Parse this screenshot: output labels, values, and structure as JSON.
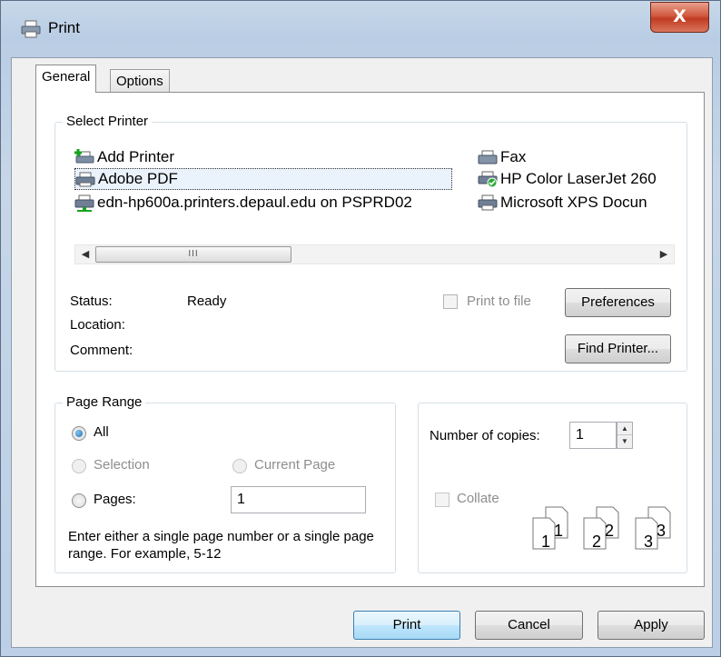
{
  "window": {
    "title": "Print",
    "close_glyph": "X"
  },
  "tabs": [
    {
      "label": "General",
      "active": true
    },
    {
      "label": "Options",
      "active": false
    }
  ],
  "select_printer": {
    "group_label": "Select Printer",
    "printers": [
      {
        "name": "Add Printer",
        "icon": "add-printer-icon"
      },
      {
        "name": "Adobe PDF",
        "icon": "printer-icon",
        "selected": true
      },
      {
        "name": "edn-hp600a.printers.depaul.edu on PSPRD02",
        "icon": "network-printer-icon"
      },
      {
        "name": "Fax",
        "icon": "fax-icon"
      },
      {
        "name": "HP Color LaserJet 260",
        "icon": "default-printer-icon"
      },
      {
        "name": "Microsoft XPS Docun",
        "icon": "printer-icon"
      }
    ],
    "status_label": "Status:",
    "status_value": "Ready",
    "location_label": "Location:",
    "comment_label": "Comment:",
    "print_to_file_label": "Print to file",
    "preferences_button": "Preferences",
    "find_printer_button": "Find Printer..."
  },
  "page_range": {
    "group_label": "Page Range",
    "all_label": "All",
    "selection_label": "Selection",
    "current_page_label": "Current Page",
    "pages_label": "Pages:",
    "pages_value": "1",
    "hint": "Enter either a single page number or a single page range.  For example, 5-12"
  },
  "copies": {
    "number_label": "Number of copies:",
    "number_value": "1",
    "collate_label": "Collate",
    "collate_pages": [
      "1",
      "1",
      "2",
      "2",
      "3",
      "3"
    ]
  },
  "footer": {
    "print_button": "Print",
    "cancel_button": "Cancel",
    "apply_button": "Apply"
  },
  "colors": {
    "accent": "#3c7fb1",
    "selection": "#eaf2fb",
    "close": "#c13b21"
  }
}
